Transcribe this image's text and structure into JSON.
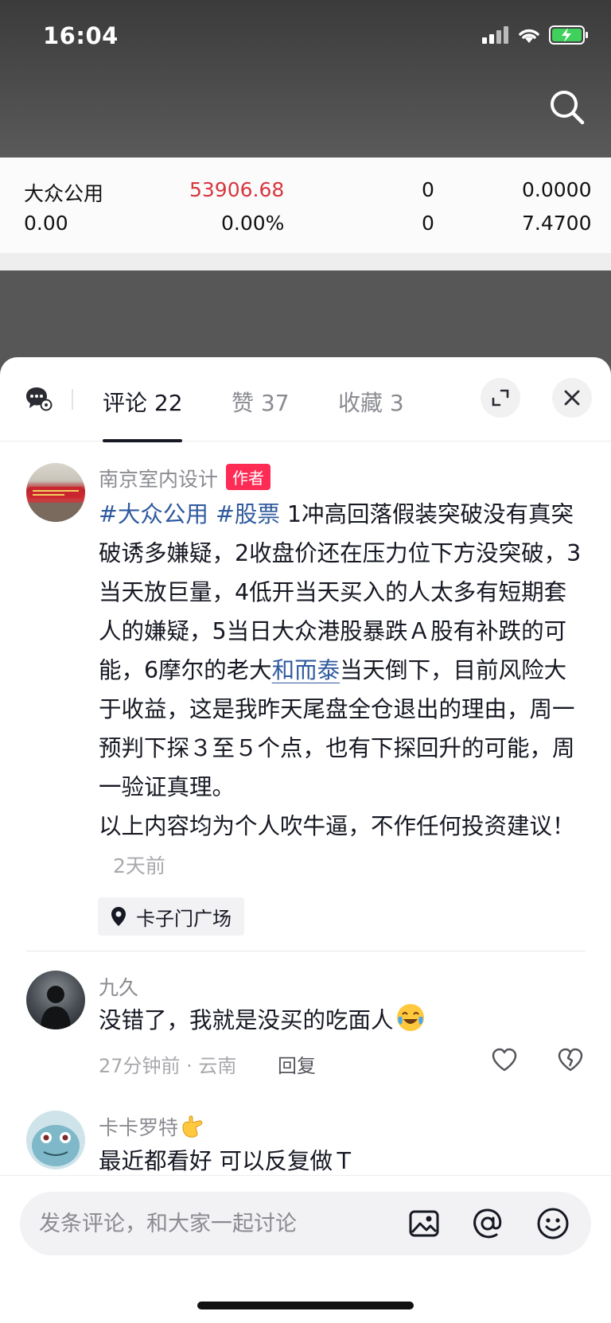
{
  "status_bar": {
    "time": "16:04"
  },
  "stock": {
    "name": "大众公用",
    "price": "53906.68",
    "col3_row1": "0",
    "col4_row1": "0.0000",
    "change": "0.00",
    "change_pct": "0.00%",
    "col3_row2": "0",
    "col4_row2": "7.4700"
  },
  "tabs": {
    "comments": "评论 22",
    "likes": "赞 37",
    "favorites": "收藏 3"
  },
  "comments": [
    {
      "name": "南京室内设计",
      "tag": "作者",
      "hashtag1": "#大众公用",
      "hashtag2": "#股票",
      "text_a": "1冲高回落假装突破没有真突破诱多嫌疑，2收盘价还在压力位下方没突破，3当天放巨量，4低开当天买入的人太多有短期套人的嫌疑，5当日大众港股暴跌Ａ股有补跌的可能，6摩尔的老大",
      "link": "和而泰",
      "text_b": "当天倒下，目前风险大于收益，这是我昨天尾盘全仓退出的理由，周一预判下探３至５个点，也有下探回升的可能，周一验证真理。",
      "text_c": "以上内容均为个人吹牛逼，不作任何投资建议！",
      "time": "2天前",
      "location": "卡子门广场"
    },
    {
      "name": "九久",
      "text": "没错了，我就是没买的吃面人",
      "meta": "27分钟前 · 云南",
      "reply": "回复"
    },
    {
      "name": "卡卡罗特",
      "text": "最近都看好  可以反复做Ｔ"
    }
  ],
  "input": {
    "placeholder": "发条评论，和大家一起讨论"
  }
}
